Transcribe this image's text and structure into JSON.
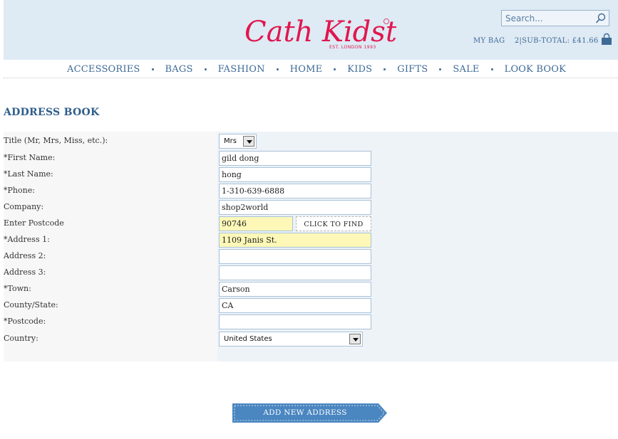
{
  "header": {
    "logo_text": "Cath Kidston",
    "logo_tagline": "EST. LONDON 1993",
    "search_placeholder": "Search...",
    "bag_label": "MY BAG",
    "bag_count": "2",
    "subtotal": "|SUB-TOTAL: £41.66"
  },
  "nav": {
    "items": [
      "ACCESSORIES",
      "BAGS",
      "FASHION",
      "HOME",
      "KIDS",
      "GIFTS",
      "SALE",
      "LOOK BOOK"
    ]
  },
  "page": {
    "title": "ADDRESS BOOK"
  },
  "form": {
    "title_label": "Title (Mr, Mrs, Miss, etc.):",
    "title_value": "Mrs",
    "first_name_label": "*First Name:",
    "first_name_value": "gild dong",
    "last_name_label": "*Last Name:",
    "last_name_value": "hong",
    "phone_label": "*Phone:",
    "phone_value": "1-310-639-6888",
    "company_label": "Company:",
    "company_value": "shop2world",
    "enter_postcode_label": "Enter Postcode",
    "enter_postcode_value": "90746",
    "find_button": "CLICK TO FIND",
    "address1_label": "*Address 1:",
    "address1_value": "1109 Janis St.",
    "address2_label": "Address 2:",
    "address2_value": "",
    "address3_label": "Address 3:",
    "address3_value": "",
    "town_label": "*Town:",
    "town_value": "Carson",
    "county_label": "County/State:",
    "county_value": "CA",
    "postcode_label": "*Postcode:",
    "postcode_value": "",
    "country_label": "Country:",
    "country_value": "United States"
  },
  "actions": {
    "add_address": "ADD NEW ADDRESS"
  },
  "colors": {
    "header_bg": "#deeaf4",
    "brand_pink": "#e0174f",
    "link_blue": "#3e6a96",
    "button_blue": "#4a86c0",
    "highlight_yellow": "#fdf8b8"
  }
}
